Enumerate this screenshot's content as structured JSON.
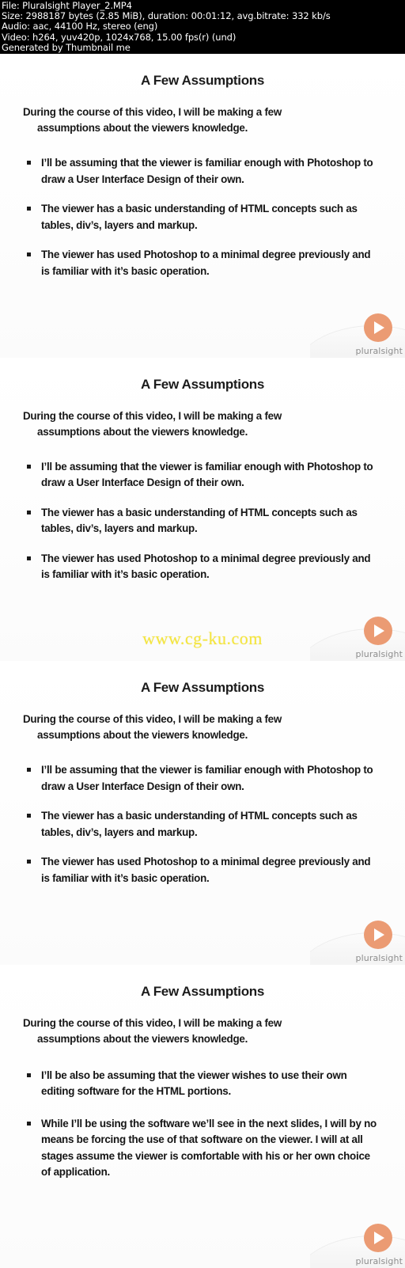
{
  "info_header": {
    "lines": [
      "File: Pluralsight Player_2.MP4",
      "Size: 2988187 bytes (2.85 MiB), duration: 00:01:12, avg.bitrate: 332 kb/s",
      "Audio: aac, 44100 Hz, stereo (eng)",
      "Video: h264, yuv420p, 1024x768, 15.00 fps(r) (und)",
      "Generated by Thumbnail me"
    ]
  },
  "brand": {
    "name": "pluralsight",
    "play_icon": "play-triangle-icon",
    "accent_color": "#eb9b73"
  },
  "watermark": {
    "text": "www.cg-ku.com",
    "color": "#f5e63c"
  },
  "frames": [
    {
      "title": "A Few Assumptions",
      "intro_line1": "During the course of this video, I will be making a few",
      "intro_line2": "assumptions about the viewers knowledge.",
      "bullets": [
        "I’ll be assuming that the viewer is familiar enough with Photoshop to draw a User Interface Design of their own.",
        "The viewer has a basic understanding of HTML concepts such as tables, div’s, layers and markup.",
        "The viewer has used Photoshop to a minimal degree previously and is familiar with it’s basic operation."
      ]
    },
    {
      "title": "A Few Assumptions",
      "intro_line1": "During the course of this video, I will be making a few",
      "intro_line2": "assumptions about the viewers knowledge.",
      "bullets": [
        "I’ll be assuming that the viewer is familiar enough with Photoshop to draw a User Interface Design of their own.",
        "The viewer has a basic understanding of HTML concepts such as tables, div’s, layers and markup.",
        "The viewer has used Photoshop to a minimal degree previously and is familiar with it’s basic operation."
      ]
    },
    {
      "title": "A Few Assumptions",
      "intro_line1": "During the course of this video, I will be making a few",
      "intro_line2": "assumptions about the viewers knowledge.",
      "bullets": [
        "I’ll be assuming that the viewer is familiar enough with Photoshop to draw a User Interface Design of their own.",
        "The viewer has a basic understanding of HTML concepts such as tables, div’s, layers and markup.",
        "The viewer has used Photoshop to a minimal degree previously and is familiar with it’s basic operation."
      ]
    },
    {
      "title": "A Few Assumptions",
      "intro_line1": "During the course of this video, I will be making a few",
      "intro_line2": "assumptions about the viewers knowledge.",
      "bullets": [
        "I’ll be also be assuming that the viewer wishes to use their own editing software for the HTML portions.",
        "While I’ll be using the software we’ll see in the next slides, I will by no means be forcing the use of that software on the viewer.  I will at all stages assume the viewer is comfortable with his or her own choice of application."
      ]
    }
  ]
}
